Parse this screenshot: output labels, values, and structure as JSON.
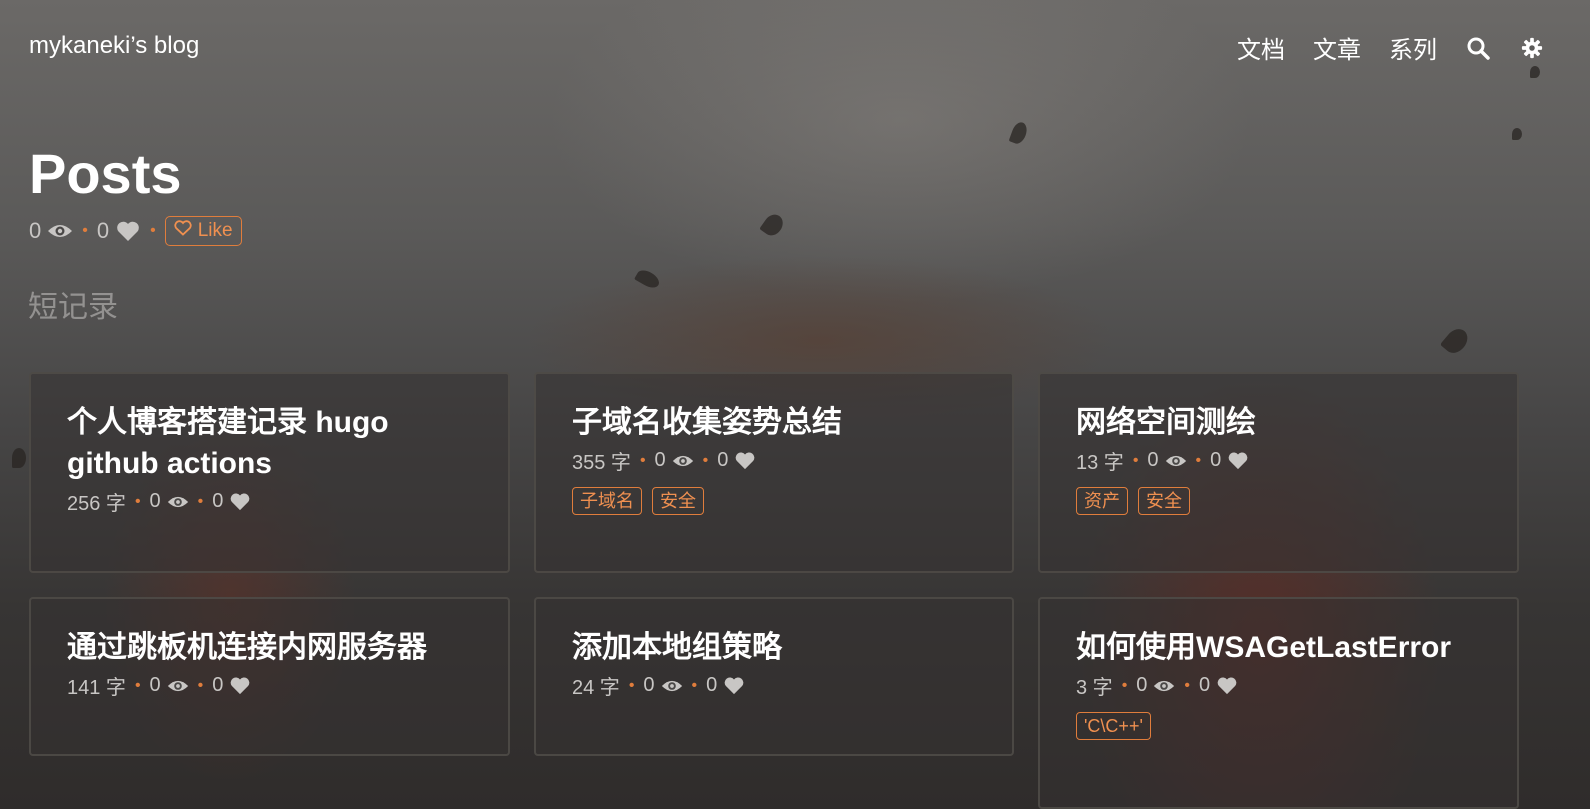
{
  "header": {
    "brand": "mykaneki’s blog",
    "nav": [
      {
        "label": "文档"
      },
      {
        "label": "文章"
      },
      {
        "label": "系列"
      }
    ],
    "icons": [
      "search-icon",
      "gear-icon"
    ]
  },
  "page": {
    "title": "Posts",
    "views": "0",
    "likes": "0",
    "like_button": "Like",
    "section": "短记录"
  },
  "posts": [
    {
      "title": "个人博客搭建记录 hugo github actions",
      "words": "256 字",
      "views": "0",
      "likes": "0",
      "tags": []
    },
    {
      "title": "子域名收集姿势总结",
      "words": "355 字",
      "views": "0",
      "likes": "0",
      "tags": [
        "子域名",
        "安全"
      ]
    },
    {
      "title": "网络空间测绘",
      "words": "13 字",
      "views": "0",
      "likes": "0",
      "tags": [
        "资产",
        "安全"
      ]
    },
    {
      "title": "通过跳板机连接内网服务器",
      "words": "141 字",
      "views": "0",
      "likes": "0",
      "tags": []
    },
    {
      "title": "添加本地组策略",
      "words": "24 字",
      "views": "0",
      "likes": "0",
      "tags": []
    },
    {
      "title": "如何使用WSAGetLastError",
      "words": "3 字",
      "views": "0",
      "likes": "0",
      "tags": [
        "'C\\C++'"
      ]
    }
  ],
  "colors": {
    "accent": "#e07d3c",
    "text": "#ffffff",
    "muted": "#c8c6c4"
  }
}
